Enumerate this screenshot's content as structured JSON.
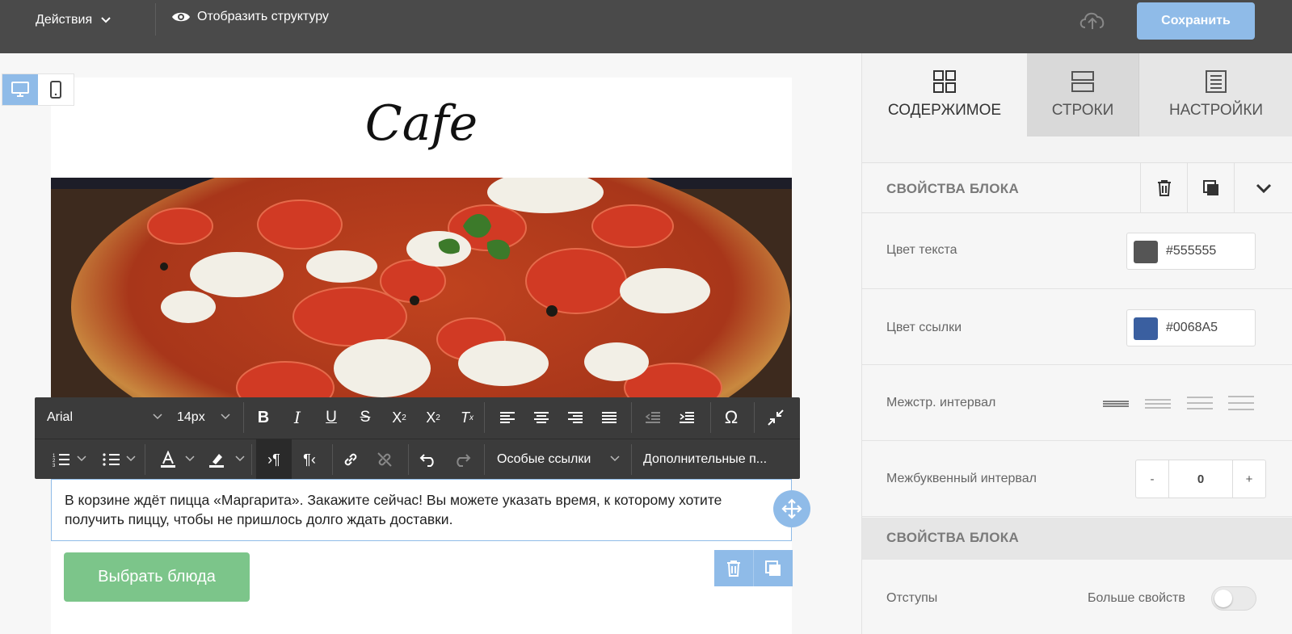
{
  "topbar": {
    "actions_label": "Действия",
    "structure_label": "Отобразить структуру",
    "save_label": "Сохранить"
  },
  "email": {
    "title": "Cafe",
    "body_text": "В корзине ждёт пицца «Маргарита». Закажите сейчас! Вы можете указать время, к которому хотите получить пиццу, чтобы не пришлось долго ждать доставки.",
    "button_label": "Выбрать блюда"
  },
  "editor_toolbar": {
    "font_family": "Arial",
    "font_size": "14px",
    "special_links": "Особые ссылки",
    "more_options": "Дополнительные п..."
  },
  "panel": {
    "tabs": [
      {
        "label": "СОДЕРЖИМОЕ"
      },
      {
        "label": "СТРОКИ"
      },
      {
        "label": "НАСТРОЙКИ"
      }
    ],
    "section1_title": "СВОЙСТВА БЛОКА",
    "text_color_label": "Цвет текста",
    "text_color_value": "#555555",
    "link_color_label": "Цвет ссылки",
    "link_color_value": "#0068A5",
    "line_height_label": "Межстр. интервал",
    "letter_spacing_label": "Межбуквенный интервал",
    "letter_spacing_minus": "-",
    "letter_spacing_value": "0",
    "letter_spacing_plus": "+",
    "section2_title": "СВОЙСТВА БЛОКА",
    "padding_label": "Отступы",
    "more_props_label": "Больше свойств"
  },
  "colors": {
    "topbar_bg": "#4a4a4a",
    "accent_blue": "#8fbbe8",
    "cta_green": "#7cc58a",
    "text_swatch": "#555555",
    "link_swatch": "#0068A5"
  }
}
